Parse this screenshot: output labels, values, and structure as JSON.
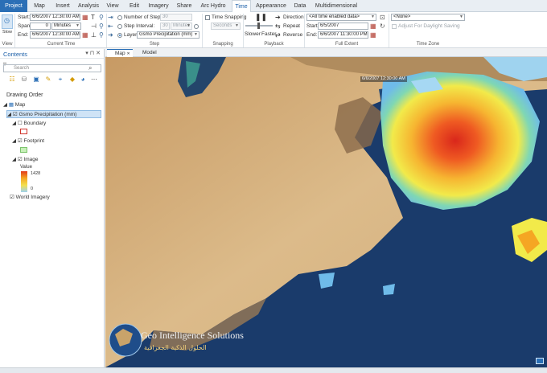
{
  "tabs": [
    "Project",
    "Map",
    "Insert",
    "Analysis",
    "View",
    "Edit",
    "Imagery",
    "Share",
    "Arc Hydro",
    "Time",
    "Appearance",
    "Data",
    "Multidimensional"
  ],
  "ribbon": {
    "view_label": "View",
    "slow_label": "Slow",
    "current_time": {
      "start_label": "Start:",
      "start_value": "6/6/2007 12:30:00 AM",
      "span_label": "Span:",
      "span_value": "0",
      "span_unit": "Minutes",
      "end_label": "End:",
      "end_value": "6/6/2007 12:30:00 AM",
      "group_label": "Current Time"
    },
    "step": {
      "num_steps_label": "Number of Steps:",
      "num_steps_value": "30",
      "step_interval_label": "Step Interval:",
      "step_interval_value": "30",
      "step_interval_unit": "Minutes",
      "layer_label": "Layer:",
      "layer_value": "Gsmo Precipitation (mm)",
      "group_label": "Step"
    },
    "snapping": {
      "time_snapping_label": "Time Snapping",
      "unit_value": "Seconds",
      "group_label": "Snapping"
    },
    "playback": {
      "slower_label": "Slower",
      "faster_label": "Faster",
      "direction_label": "Direction",
      "repeat_label": "Repeat",
      "reverse_label": "Reverse",
      "group_label": "Playback"
    },
    "full_extent": {
      "preset_value": "<All time enabled data>",
      "start_label": "Start:",
      "start_value": "6/5/2007",
      "end_label": "End:",
      "end_value": "6/6/2007 11:30:00 PM",
      "group_label": "Full Extent"
    },
    "time_zone": {
      "zone_value": "<None>",
      "dst_label": "Adjust For Daylight Saving",
      "group_label": "Time Zone"
    }
  },
  "contents": {
    "title": "Contents",
    "search_placeholder": "Search",
    "drawing_order_label": "Drawing Order",
    "map_label": "Map",
    "layer_name": "Gsmo Precipitation (mm)",
    "boundary_label": "Boundary",
    "footprint_label": "Footprint",
    "image_label": "Image",
    "value_label": "Value",
    "value_max": "1428",
    "value_min": "0",
    "basemap_label": "World Imagery"
  },
  "view_tabs": [
    "Map",
    "Model"
  ],
  "map": {
    "extent_label": "6/6/2007 12:30:00 AM",
    "watermark_title": "Geo Intelligence Solutions",
    "watermark_arabic": "الحلول الذكية الجغرافية"
  },
  "colors": {
    "accent": "#2b6fb6",
    "land": "#d9b788",
    "sea": "#1a3b6b",
    "precip_high": "#e23a1c",
    "precip_low": "#9fd3ef"
  }
}
